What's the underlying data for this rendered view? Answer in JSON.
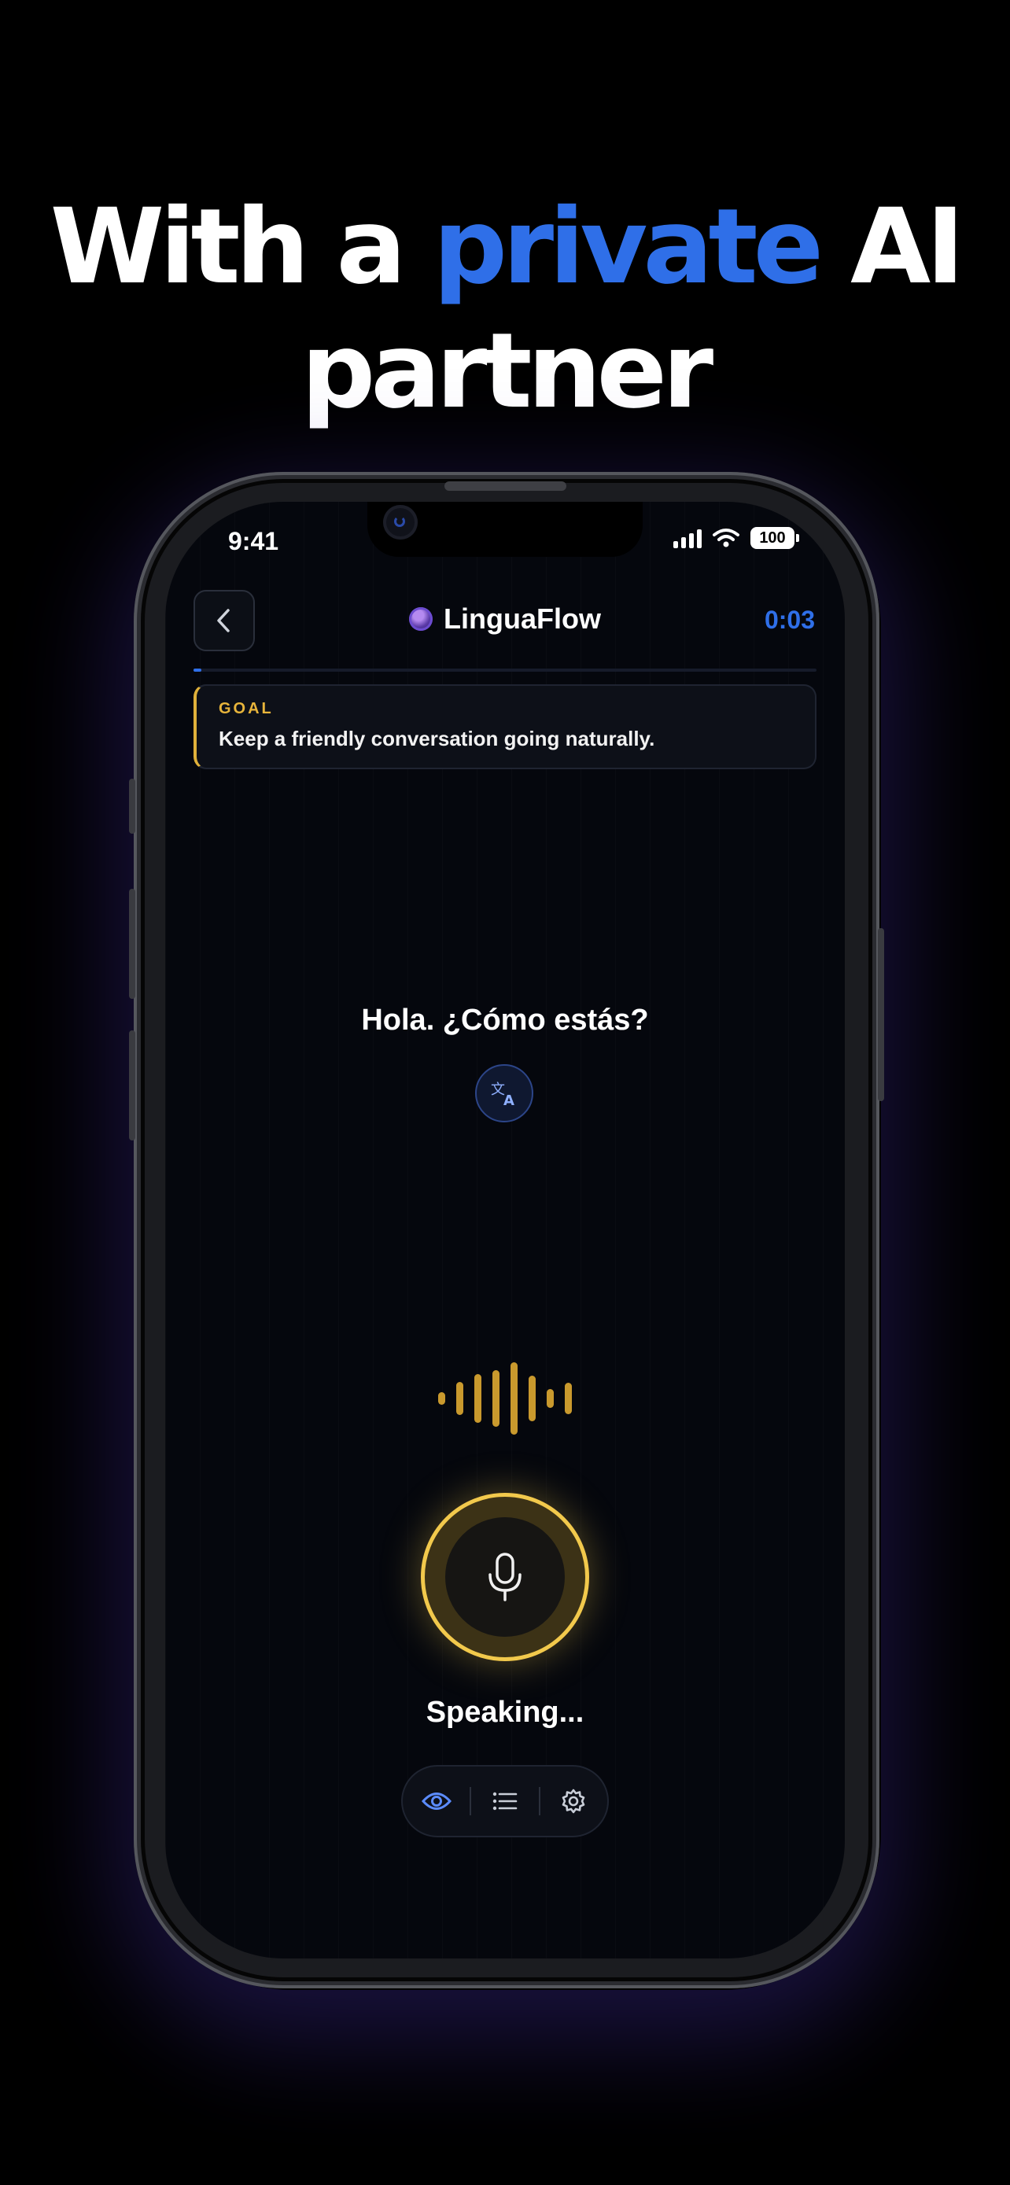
{
  "headline": {
    "part1": "With a",
    "highlight": "private",
    "part2": "AI",
    "line2": "partner",
    "highlight_color": "#2f6fe8"
  },
  "status_bar": {
    "time": "9:41",
    "battery": "100",
    "icons": [
      "cellular-signal-icon",
      "wifi-icon",
      "battery-icon"
    ]
  },
  "header": {
    "back_icon": "chevron-left-icon",
    "app_icon": "globe-icon",
    "title": "LinguaFlow",
    "timer": "0:03",
    "timer_color": "#2f6fe8"
  },
  "progress": {
    "value": 0.01
  },
  "goal": {
    "label": "GOAL",
    "text": "Keep a friendly conversation going naturally.",
    "accent": "#e8b53b"
  },
  "conversation": {
    "phrase": "Hola. ¿Cómo estás?",
    "translate_icon": "translate-icon"
  },
  "voice": {
    "waveform_icon": "audio-waveform-icon",
    "mic_icon": "microphone-icon",
    "status": "Speaking...",
    "accent": "#f2c94c"
  },
  "toolbar": {
    "items": [
      {
        "icon": "eye-icon",
        "active": true
      },
      {
        "icon": "list-icon",
        "active": false
      },
      {
        "icon": "gear-icon",
        "active": false
      }
    ]
  }
}
